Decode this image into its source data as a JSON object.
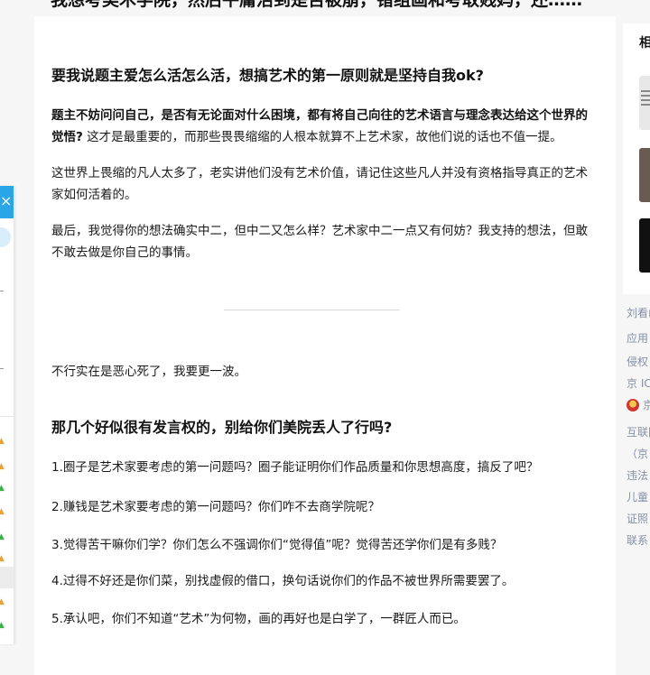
{
  "page": {
    "top_title": "我想考美术学院，然后平庸活到是否被崩，错组画和考取贱妈，还……"
  },
  "answer": {
    "heading1": "要我说题主爱怎么活怎么活，想搞艺术的第一原则就是坚持自我ok?",
    "p1_bold": "题主不妨问问自己，是否有无论面对什么困境，都有将自己向往的艺术语言与理念表达给这个世界的觉悟?",
    "p1_rest": " 这才是最重要的，而那些畏畏缩缩的人根本就算不上艺术家，故他们说的话也不值一提。",
    "p2": "这世界上畏缩的凡人太多了，老实讲他们没有艺术价值，请记住这些凡人并没有资格指导真正的艺术家如何活着的。",
    "p3": "最后，我觉得你的想法确实中二，但中二又怎么样？艺术家中二一点又有何妨？我支持的想法，但敢不敢去做是你自己的事情。",
    "p4": "不行实在是恶心死了，我要更一波。",
    "heading2": "那几个好似很有发言权的，别给你们美院丢人了行吗?",
    "list": [
      "1.圈子是艺术家要考虑的第一问题吗？圈子能证明你们作品质量和你思想高度，搞反了吧？",
      "2.赚钱是艺术家要考虑的第一问题吗？你们咋不去商学院呢？",
      "3.觉得苦干嘛你们学？你们怎么不强调你们“觉得值”呢？觉得苦还学你们是有多贱？",
      "4.过得不好还是你们菜，别找虚假的借口，换句话说你们的作品不被世界所需要罢了。",
      "5.承认吧，你们不知道“艺术”为何物，画的再好也是白学了，一群匠人而已。"
    ]
  },
  "left_panel": {
    "close_glyph": "×"
  },
  "sidebar": {
    "card_title": "相关",
    "footer_links": [
      "刘看山",
      "应用",
      "侵权",
      "京 IC"
    ],
    "badge_text": "京",
    "footer_links2": [
      "互联网",
      "（京",
      "违法",
      "儿童",
      "证照",
      "联系"
    ]
  },
  "colors": {
    "accent_blue": "#2aa6e8",
    "link_gray": "#8590a6",
    "card_bg": "#ffffff",
    "page_bg": "#f6f6f6"
  }
}
